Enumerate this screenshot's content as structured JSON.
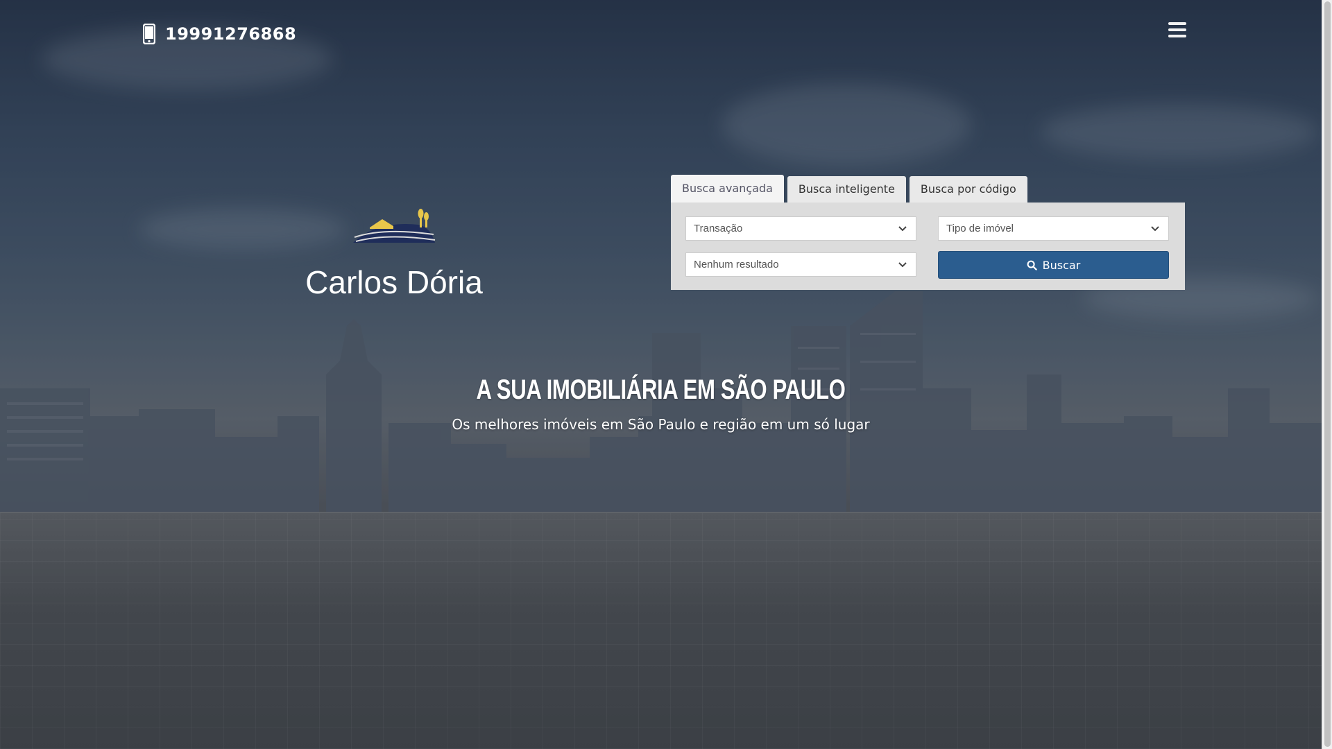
{
  "header": {
    "phone": "19991276868",
    "menu_icon": "hamburger-menu-icon"
  },
  "brand": {
    "name": "Carlos Dória",
    "accent": "#e8c64a",
    "navy": "#1f2d5a"
  },
  "search": {
    "tabs": [
      {
        "label": "Busca avançada",
        "active": true
      },
      {
        "label": "Busca inteligente",
        "active": false
      },
      {
        "label": "Busca por código",
        "active": false
      }
    ],
    "transacao": "Transação",
    "tipo_imovel": "Tipo de imóvel",
    "localidade": "Nenhum resultado",
    "button_label": "Buscar",
    "button_color": "#2b5d8f"
  },
  "hero": {
    "title": "A SUA IMOBILIÁRIA EM SÃO PAULO",
    "subtitle": "Os melhores imóveis em São Paulo e região em um só lugar"
  }
}
